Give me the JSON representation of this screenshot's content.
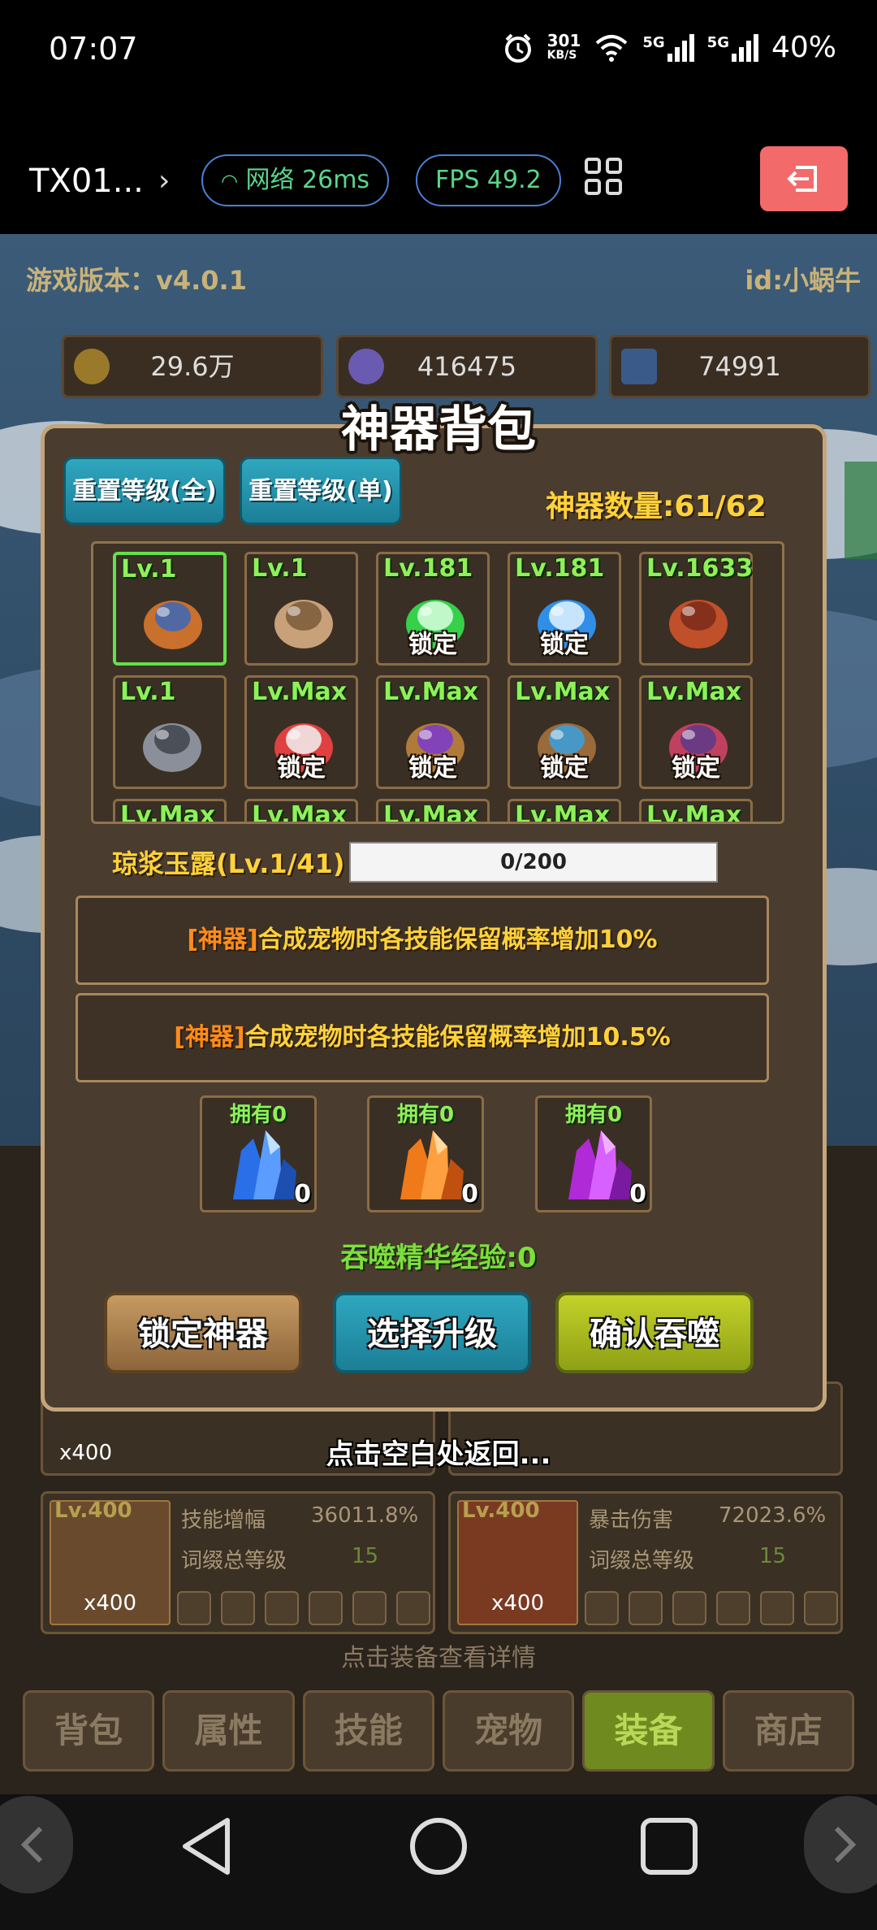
{
  "status_bar": {
    "time": "07:07",
    "net_speed": "301",
    "net_unit": "KB/S",
    "signal1": "5G",
    "signal2": "5G",
    "battery": "40%"
  },
  "toolbar": {
    "title": "TX01...",
    "network": "网络 26ms",
    "fps": "FPS 49.2"
  },
  "game": {
    "version": "游戏版本：v4.0.1",
    "player_id": "id:小蜗牛",
    "resources": [
      "29.6万",
      "416475",
      "74991"
    ]
  },
  "modal": {
    "title": "神器背包",
    "reset_all": "重置等级(全)",
    "reset_single": "重置等级(单)",
    "artifact_count": "神器数量:61/62",
    "items": [
      {
        "level": "Lv.1",
        "locked": "",
        "icon": "pot-icon",
        "colors": [
          "#c9702c",
          "#3b67b8"
        ],
        "selected": true
      },
      {
        "level": "Lv.1",
        "locked": "",
        "icon": "scroll-icon",
        "colors": [
          "#c8a07a",
          "#7a5a3a"
        ],
        "selected": false
      },
      {
        "level": "Lv.181",
        "locked": "锁定",
        "icon": "green-gem-icon",
        "colors": [
          "#36d04a",
          "#d8ffe0"
        ],
        "selected": false
      },
      {
        "level": "Lv.181",
        "locked": "锁定",
        "icon": "blue-gem-icon",
        "colors": [
          "#2f8ee8",
          "#e0f4ff"
        ],
        "selected": false
      },
      {
        "level": "Lv.1633",
        "locked": "",
        "icon": "red-pouch-icon",
        "colors": [
          "#c0502a",
          "#7a2a1a"
        ],
        "selected": false
      },
      {
        "level": "Lv.1",
        "locked": "",
        "icon": "anvil-icon",
        "colors": [
          "#8a8f9a",
          "#40444c"
        ],
        "selected": false
      },
      {
        "level": "Lv.Max",
        "locked": "锁定",
        "icon": "potion-icon",
        "colors": [
          "#e04040",
          "#f2f2f2"
        ],
        "selected": false
      },
      {
        "level": "Lv.Max",
        "locked": "锁定",
        "icon": "bucket-icon",
        "colors": [
          "#b07a3a",
          "#7a3ad0"
        ],
        "selected": false
      },
      {
        "level": "Lv.Max",
        "locked": "锁定",
        "icon": "armor-icon",
        "colors": [
          "#9a6a3a",
          "#3aa0e0"
        ],
        "selected": false
      },
      {
        "level": "Lv.Max",
        "locked": "锁定",
        "icon": "wings-icon",
        "colors": [
          "#c04060",
          "#5a3a8a"
        ],
        "selected": false
      }
    ],
    "partial_row_label": "Lv.Max",
    "jade_label": "琼浆玉露(Lv.1/41)",
    "progress_text": "0/200",
    "progress_fraction": 0,
    "effect_tag_1": "[神器]",
    "effect_text_1": "合成宠物时各技能保留概率增加10%",
    "effect_tag_2": "[神器]",
    "effect_text_2": "合成宠物时各技能保留概率增加10.5%",
    "crystals": [
      {
        "owned": "拥有0",
        "count": "0",
        "icon": "blue-crystal-icon",
        "colors": [
          "#2a6ee8",
          "#bfe0ff"
        ]
      },
      {
        "owned": "拥有0",
        "count": "0",
        "icon": "orange-crystal-icon",
        "colors": [
          "#f07a1a",
          "#ffd9a0"
        ]
      },
      {
        "owned": "拥有0",
        "count": "0",
        "icon": "purple-crystal-icon",
        "colors": [
          "#b02ad8",
          "#f0b0ff"
        ]
      }
    ],
    "exp_label": "吞噬精华经验:0",
    "lock_button": "锁定神器",
    "upgrade_button": "选择升级",
    "devour_button": "确认吞噬"
  },
  "tap_return": "点击空白处返回...",
  "equipment": [
    {
      "level": "Lv.400",
      "count": "x400",
      "stat": "技能增幅",
      "value": "36011.8%",
      "affix": "词缀总等级",
      "affix_val": "15"
    },
    {
      "level": "Lv.400",
      "count": "x400",
      "stat": "暴击伤害",
      "value": "72023.6%",
      "affix": "词缀总等级",
      "affix_val": "15"
    }
  ],
  "upper_cards": [
    {
      "count": "x400"
    }
  ],
  "tap_detail": "点击装备查看详情",
  "tabs": [
    "背包",
    "属性",
    "技能",
    "宠物",
    "装备",
    "商店"
  ],
  "active_tab": "装备"
}
